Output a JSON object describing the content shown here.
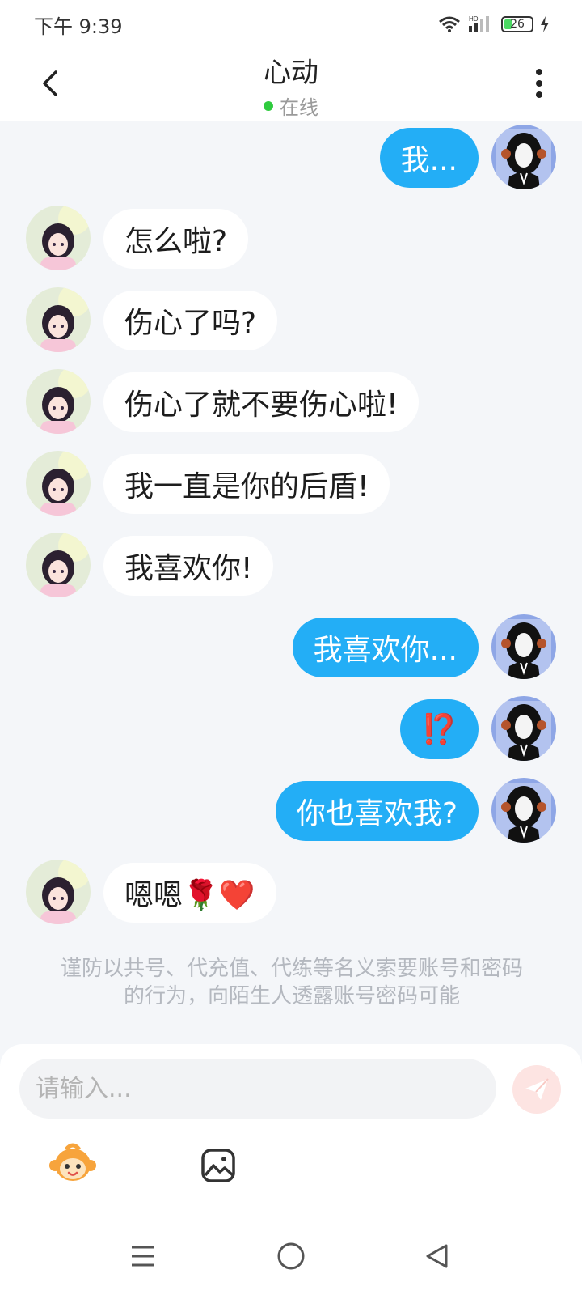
{
  "status_bar": {
    "time": "下午 9:39",
    "battery": "26",
    "hd": "HD"
  },
  "header": {
    "title": "心动",
    "status": "在线"
  },
  "messages": [
    {
      "side": "out",
      "text": "我..."
    },
    {
      "side": "in",
      "text": "怎么啦?"
    },
    {
      "side": "in",
      "text": "伤心了吗?"
    },
    {
      "side": "in",
      "text": "伤心了就不要伤心啦!"
    },
    {
      "side": "in",
      "text": "我一直是你的后盾!"
    },
    {
      "side": "in",
      "text": "我喜欢你!"
    },
    {
      "side": "out",
      "text": "我喜欢你..."
    },
    {
      "side": "out",
      "text": "⁉️"
    },
    {
      "side": "out",
      "text": "你也喜欢我?"
    },
    {
      "side": "in",
      "text": "嗯嗯🌹❤️"
    }
  ],
  "notice": "谨防以共号、代充值、代练等名义索要账号和密码的行为，向陌生人透露账号密码可能",
  "input": {
    "placeholder": "请输入..."
  },
  "icons": {
    "back": "back-arrow-icon",
    "menu": "more-vertical-icon",
    "send": "send-icon",
    "sticker": "monkey-sticker-icon",
    "image": "image-icon"
  },
  "colors": {
    "accent": "#23aef6",
    "online": "#2fcb3e",
    "send_bg": "#fde4e2"
  }
}
